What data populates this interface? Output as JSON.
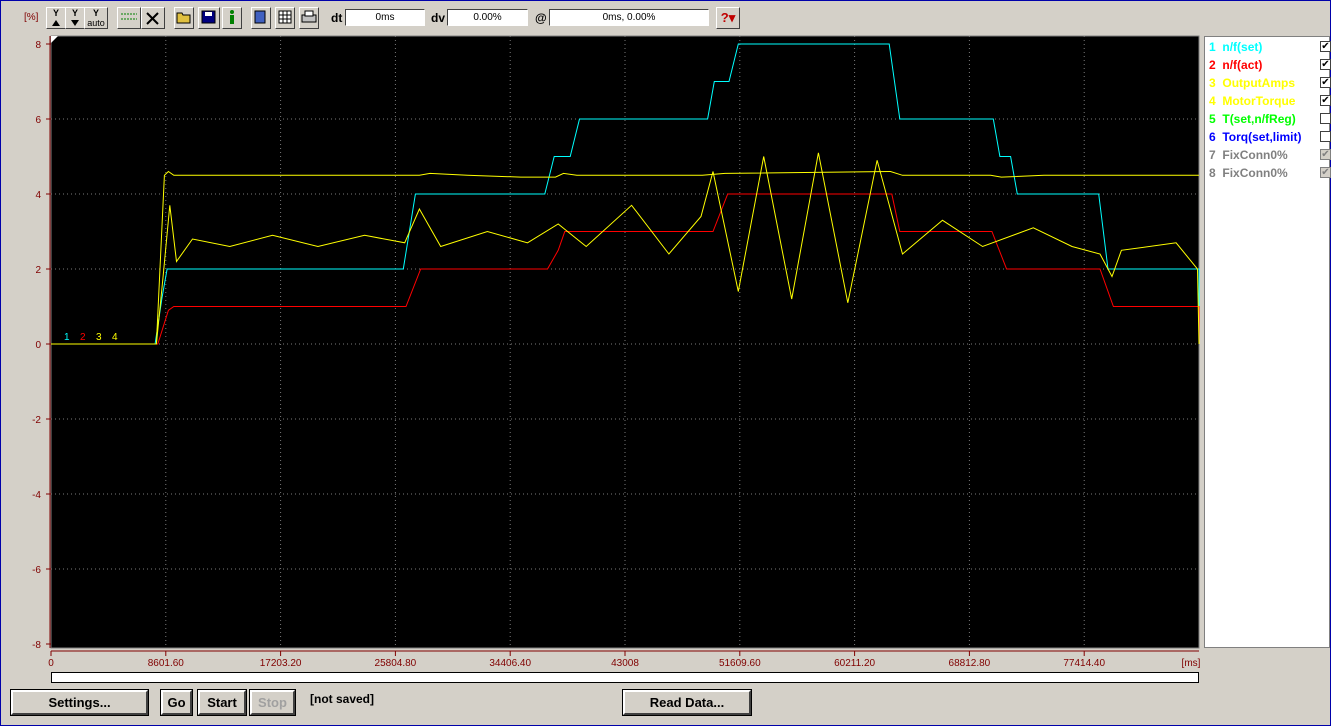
{
  "toolbar": {
    "unit_label": "[%]",
    "dt_label": "dt",
    "dt_value": "0ms",
    "dv_label": "dv",
    "dv_value": "0.00%",
    "at_label": "@",
    "at_value": "0ms, 0.00%",
    "auto_label": "auto",
    "y_label": "Y"
  },
  "chart_data": {
    "type": "line",
    "ylim": [
      -8,
      8
    ],
    "y_ticks": [
      "8",
      "6",
      "4",
      "2",
      "0",
      "-2",
      "-4",
      "-6",
      "-8"
    ],
    "xlim": [
      0,
      86016
    ],
    "x_ticks": [
      "0",
      "8601.60",
      "17203.20",
      "25804.80",
      "34406.40",
      "43008",
      "51609.60",
      "60211.20",
      "68812.80",
      "77414.40"
    ],
    "x_unit": "[ms]",
    "trace_numbers": [
      "1",
      "2",
      "3",
      "4"
    ],
    "series": [
      {
        "name": "n/f(set)",
        "color": "#00ffff",
        "points": [
          [
            0,
            0
          ],
          [
            7800,
            0
          ],
          [
            8300,
            1.2
          ],
          [
            8700,
            2
          ],
          [
            26400,
            2
          ],
          [
            27300,
            4
          ],
          [
            37000,
            4
          ],
          [
            37700,
            5
          ],
          [
            38900,
            5
          ],
          [
            39600,
            6
          ],
          [
            49200,
            6
          ],
          [
            49700,
            7
          ],
          [
            50800,
            7
          ],
          [
            51500,
            8
          ],
          [
            62800,
            8
          ],
          [
            63600,
            6
          ],
          [
            70600,
            6
          ],
          [
            71100,
            5
          ],
          [
            71900,
            5
          ],
          [
            72400,
            4
          ],
          [
            78500,
            4
          ],
          [
            79200,
            2
          ],
          [
            86016,
            2
          ],
          [
            86016,
            0
          ]
        ]
      },
      {
        "name": "n/f(act)",
        "color": "#ff0000",
        "points": [
          [
            0,
            0
          ],
          [
            8000,
            0
          ],
          [
            8800,
            0.9
          ],
          [
            9200,
            1
          ],
          [
            26600,
            1
          ],
          [
            27700,
            2
          ],
          [
            37200,
            2
          ],
          [
            38000,
            2.5
          ],
          [
            38500,
            3
          ],
          [
            49600,
            3
          ],
          [
            50700,
            4
          ],
          [
            63000,
            4
          ],
          [
            63600,
            3
          ],
          [
            70500,
            3
          ],
          [
            71600,
            2
          ],
          [
            78600,
            2
          ],
          [
            79600,
            1
          ],
          [
            86016,
            1
          ],
          [
            86016,
            0
          ]
        ]
      },
      {
        "name": "OutputAmps",
        "color": "#ffff00",
        "points": [
          [
            0,
            0
          ],
          [
            7900,
            0
          ],
          [
            8500,
            4.5
          ],
          [
            8800,
            4.6
          ],
          [
            9200,
            4.5
          ],
          [
            27600,
            4.5
          ],
          [
            28400,
            4.55
          ],
          [
            31200,
            4.5
          ],
          [
            35200,
            4.45
          ],
          [
            37800,
            4.45
          ],
          [
            38400,
            4.55
          ],
          [
            39400,
            4.5
          ],
          [
            48800,
            4.5
          ],
          [
            50500,
            4.55
          ],
          [
            62900,
            4.6
          ],
          [
            63800,
            4.5
          ],
          [
            70400,
            4.5
          ],
          [
            71200,
            4.45
          ],
          [
            74400,
            4.5
          ],
          [
            86016,
            4.5
          ]
        ]
      },
      {
        "name": "MotorTorque",
        "color": "#ffff00",
        "points": [
          [
            0,
            0
          ],
          [
            7900,
            0
          ],
          [
            8400,
            1.8
          ],
          [
            8900,
            3.7
          ],
          [
            9400,
            2.2
          ],
          [
            10600,
            2.8
          ],
          [
            13400,
            2.6
          ],
          [
            16600,
            2.9
          ],
          [
            20000,
            2.6
          ],
          [
            23500,
            2.9
          ],
          [
            26500,
            2.7
          ],
          [
            27600,
            3.6
          ],
          [
            29200,
            2.6
          ],
          [
            32700,
            3
          ],
          [
            35700,
            2.7
          ],
          [
            38000,
            3.2
          ],
          [
            40100,
            2.6
          ],
          [
            43500,
            3.7
          ],
          [
            46300,
            2.4
          ],
          [
            48700,
            3.4
          ],
          [
            49600,
            4.6
          ],
          [
            51500,
            1.4
          ],
          [
            53400,
            5
          ],
          [
            55500,
            1.2
          ],
          [
            57500,
            5.1
          ],
          [
            59700,
            1.1
          ],
          [
            61900,
            4.9
          ],
          [
            63800,
            2.4
          ],
          [
            66800,
            3.3
          ],
          [
            69800,
            2.6
          ],
          [
            73600,
            3.1
          ],
          [
            76500,
            2.6
          ],
          [
            78600,
            2.4
          ],
          [
            79500,
            1.8
          ],
          [
            80200,
            2.5
          ],
          [
            84300,
            2.7
          ],
          [
            85900,
            2
          ],
          [
            86016,
            0
          ]
        ]
      },
      {
        "name": "T(set,n/fReg)",
        "color": "#00ff00",
        "points": []
      },
      {
        "name": "Torq(set,limit)",
        "color": "#0000ff",
        "points": []
      },
      {
        "name": "FixConn0%",
        "color": "#808080",
        "points": []
      },
      {
        "name": "FixConn0%",
        "color": "#808080",
        "points": []
      }
    ]
  },
  "legend": [
    {
      "num": "1",
      "label": "n/f(set)",
      "color": "#00ffff",
      "checked": true,
      "enabled": true
    },
    {
      "num": "2",
      "label": "n/f(act)",
      "color": "#ff0000",
      "checked": true,
      "enabled": true
    },
    {
      "num": "3",
      "label": "OutputAmps",
      "color": "#ffff00",
      "checked": true,
      "enabled": true
    },
    {
      "num": "4",
      "label": "MotorTorque",
      "color": "#ffff00",
      "checked": true,
      "enabled": true
    },
    {
      "num": "5",
      "label": "T(set,n/fReg)",
      "color": "#00ff00",
      "checked": false,
      "enabled": true
    },
    {
      "num": "6",
      "label": "Torq(set,limit)",
      "color": "#0000ff",
      "checked": false,
      "enabled": true
    },
    {
      "num": "7",
      "label": "FixConn0%",
      "color": "#808080",
      "checked": true,
      "enabled": false
    },
    {
      "num": "8",
      "label": "FixConn0%",
      "color": "#808080",
      "checked": true,
      "enabled": false
    }
  ],
  "bottom": {
    "settings_label": "Settings...",
    "go_label": "Go",
    "start_label": "Start",
    "stop_label": "Stop",
    "status_text": "[not saved]",
    "read_label": "Read Data..."
  }
}
